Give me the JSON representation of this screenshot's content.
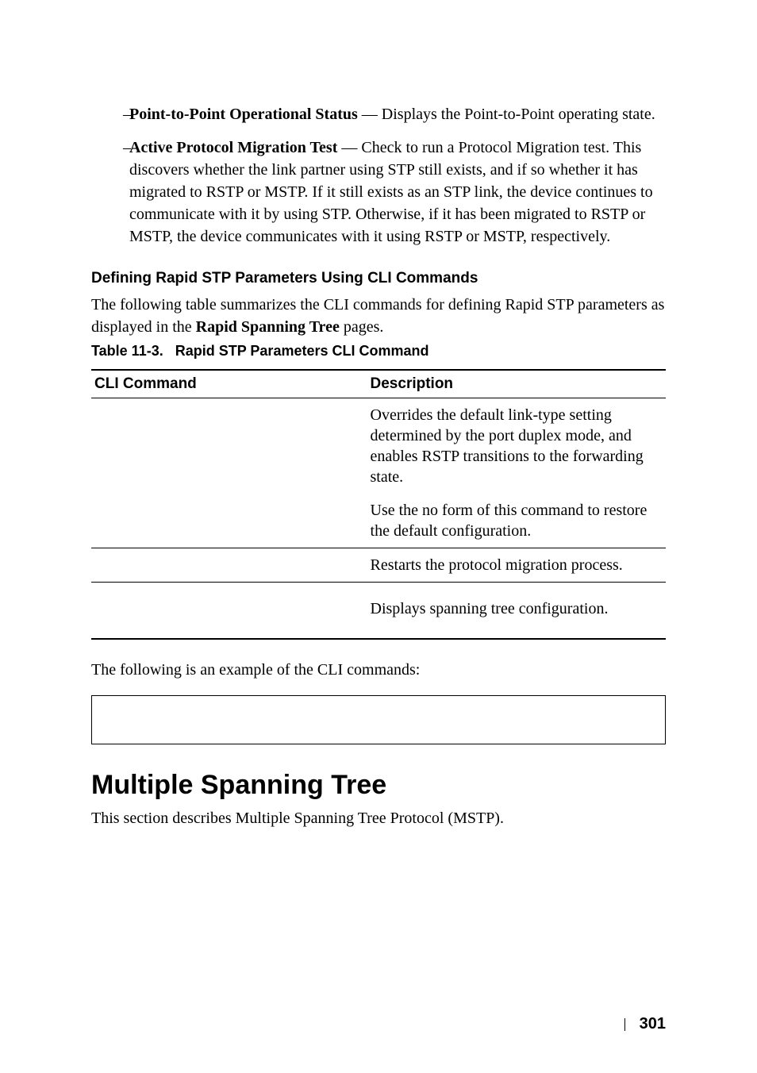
{
  "bullets": [
    {
      "dash": "–",
      "bold": "Point-to-Point Operational Status",
      "sep": " — ",
      "rest": "Displays the Point-to-Point operating state."
    },
    {
      "dash": "–",
      "bold": "Active Protocol Migration Test",
      "sep": " — ",
      "rest": "Check to run a Protocol Migration test. This discovers whether the link partner using STP still exists, and if so whether it has migrated to RSTP or MSTP. If it still exists as an STP link, the device continues to communicate with it by using STP. Otherwise, if it has been migrated to RSTP or MSTP, the device communicates with it using RSTP or MSTP, respectively."
    }
  ],
  "section_heading": "Defining Rapid STP Parameters Using CLI Commands",
  "intro_para_pre": "The following table summarizes the CLI commands for defining Rapid STP parameters as displayed in the ",
  "intro_para_bold": "Rapid Spanning Tree",
  "intro_para_post": " pages.",
  "table_caption_prefix": "Table 11-3.",
  "table_caption_title": "Rapid STP Parameters CLI Command",
  "table": {
    "head_left": "CLI Command",
    "head_right": "Description",
    "rows": [
      {
        "left": "",
        "right": "Overrides the default link-type setting determined by the port duplex mode, and enables RSTP transitions to the forwarding state."
      },
      {
        "left": "",
        "right": "Use the no form of this command to restore the default configuration."
      },
      {
        "left": "",
        "right": "Restarts the protocol migration process."
      },
      {
        "left": "",
        "right": "Displays spanning tree configuration."
      }
    ]
  },
  "example_intro": "The following is an example of the CLI commands:",
  "main_heading": "Multiple Spanning Tree",
  "main_para": "This section describes Multiple Spanning Tree Protocol (MSTP).",
  "page_number": "301"
}
